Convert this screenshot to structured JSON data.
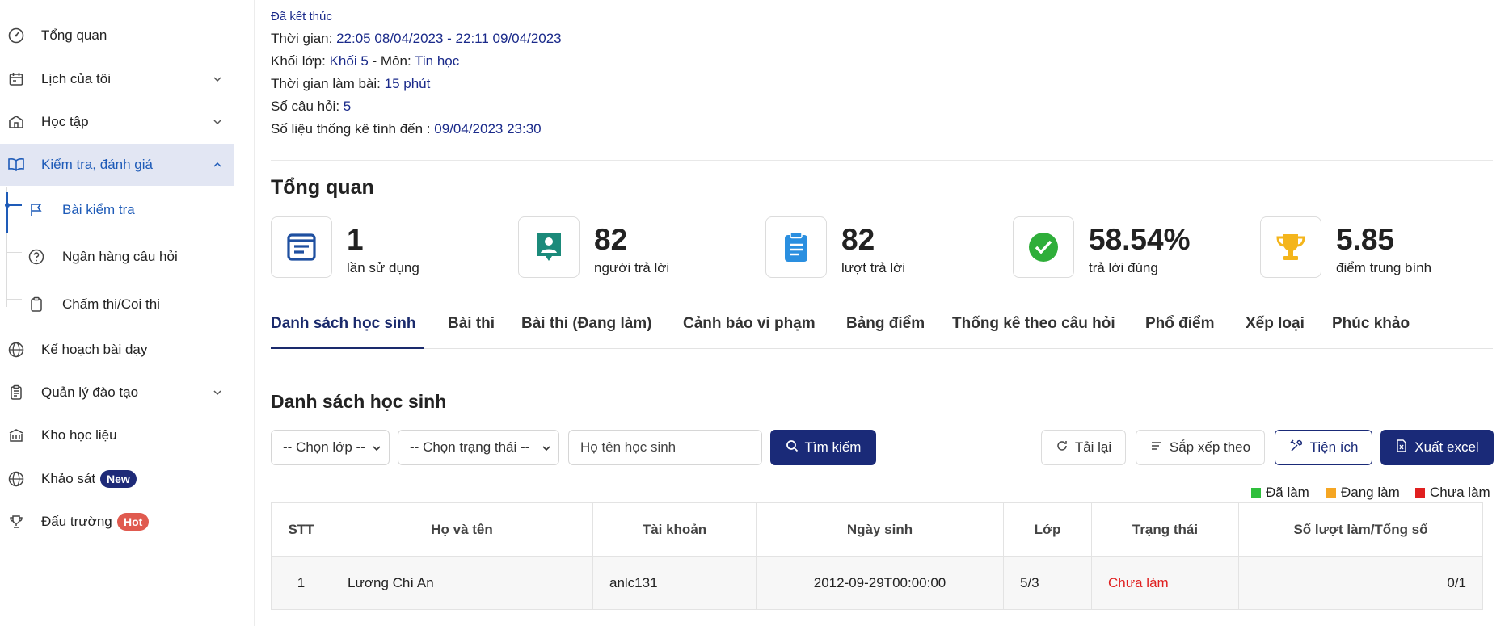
{
  "sidebar": {
    "items": [
      {
        "label": "Tổng quan",
        "icon": "dashboard-icon"
      },
      {
        "label": "Lịch của tôi",
        "icon": "calendar-icon"
      },
      {
        "label": "Học tập",
        "icon": "school-icon"
      },
      {
        "label": "Kiểm tra, đánh giá",
        "icon": "book-open-icon"
      },
      {
        "label": "Kế hoạch bài dạy",
        "icon": "globe-icon"
      },
      {
        "label": "Quản lý đào tạo",
        "icon": "clipboard-icon"
      },
      {
        "label": "Kho học liệu",
        "icon": "library-icon"
      },
      {
        "label": "Khảo sát",
        "icon": "globe-icon"
      },
      {
        "label": "Đấu trường",
        "icon": "trophy-icon"
      }
    ],
    "subitems": [
      {
        "label": "Bài kiểm tra",
        "icon": "flag-icon"
      },
      {
        "label": "Ngân hàng câu hỏi",
        "icon": "question-circle-icon"
      },
      {
        "label": "Chấm thi/Coi thi",
        "icon": "clipboard-icon"
      }
    ],
    "badges": {
      "new": "New",
      "hot": "Hot"
    }
  },
  "exam": {
    "status": "Đã kết thúc",
    "time_label": "Thời gian:",
    "time_value": "22:05 08/04/2023 - 22:11 09/04/2023",
    "grade_label": "Khối lớp:",
    "grade_value": "Khối 5",
    "subject_sep": " - Môn:",
    "subject_value": "Tin học",
    "duration_label": "Thời gian làm bài:",
    "duration_value": "15 phút",
    "questions_label": "Số câu hỏi:",
    "questions_value": "5",
    "stats_label": "Số liệu thống kê tính đến :",
    "stats_value": "09/04/2023 23:30"
  },
  "overview": {
    "title": "Tổng quan",
    "stats": [
      {
        "value": "1",
        "caption": "lần sử dụng"
      },
      {
        "value": "82",
        "caption": "người trả lời"
      },
      {
        "value": "82",
        "caption": "lượt trả lời"
      },
      {
        "value": "58.54%",
        "caption": "trả lời đúng"
      },
      {
        "value": "5.85",
        "caption": "điểm trung bình"
      }
    ]
  },
  "tabs": [
    "Danh sách học sinh",
    "Bài thi",
    "Bài thi (Đang làm)",
    "Cảnh báo vi phạm",
    "Bảng điểm",
    "Thống kê theo câu hỏi",
    "Phổ điểm",
    "Xếp loại",
    "Phúc khảo"
  ],
  "list": {
    "title": "Danh sách học sinh",
    "class_select": "-- Chọn lớp --",
    "status_select": "-- Chọn trạng thái --",
    "name_placeholder": "Họ tên học sinh",
    "search_button": "Tìm kiếm",
    "reload_button": "Tải lại",
    "sort_button": "Sắp xếp theo",
    "utility_button": "Tiện ích",
    "export_button": "Xuất excel",
    "legend": [
      {
        "label": "Đã làm",
        "color": "#2fbf3c"
      },
      {
        "label": "Đang làm",
        "color": "#f5a623"
      },
      {
        "label": "Chưa làm",
        "color": "#e02020"
      }
    ],
    "columns": [
      "STT",
      "Họ và tên",
      "Tài khoản",
      "Ngày sinh",
      "Lớp",
      "Trạng thái",
      "Số lượt làm/Tổng số"
    ],
    "rows": [
      {
        "stt": "1",
        "name": "Lương Chí An",
        "account": "anlc131",
        "dob": "2012-09-29T00:00:00",
        "class": "5/3",
        "status": "Chưa làm",
        "attempts": "0/1"
      }
    ]
  }
}
